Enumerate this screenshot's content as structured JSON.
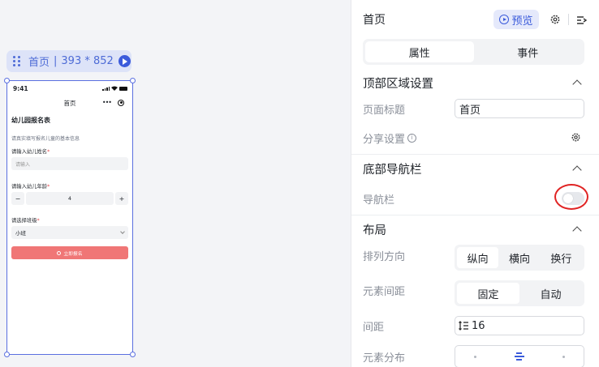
{
  "canvas": {
    "page_chip": {
      "name": "首页",
      "size": "393 * 852"
    },
    "phone": {
      "time": "9:41",
      "nav_title": "首页",
      "nav_dots": "•••",
      "form": {
        "title": "幼儿园报名表",
        "desc": "请真实填写报名儿童的基本信息",
        "name_label": "请输入幼儿姓名",
        "name_placeholder": "请输入",
        "age_label": "请输入幼儿年龄",
        "age_minus": "−",
        "age_value": "4",
        "age_plus": "+",
        "class_label": "请选择班级",
        "class_value": "小班",
        "required_mark": "*",
        "submit_label": "立即报名"
      }
    }
  },
  "panel": {
    "title": "首页",
    "preview_label": "预览",
    "tabs": [
      {
        "label": "属性",
        "active": true
      },
      {
        "label": "事件",
        "active": false
      }
    ],
    "top_section": {
      "title": "顶部区域设置",
      "page_title_label": "页面标题",
      "page_title_value": "首页",
      "share_label": "分享设置"
    },
    "bottom_section": {
      "title": "底部导航栏",
      "navbar_label": "导航栏",
      "navbar_enabled": false
    },
    "layout_section": {
      "title": "布局",
      "direction_label": "排列方向",
      "direction_options": [
        "纵向",
        "横向",
        "换行"
      ],
      "direction_selected": "纵向",
      "spacing_label": "元素间距",
      "spacing_options": [
        "固定",
        "自动"
      ],
      "spacing_selected": "固定",
      "gap_label": "间距",
      "gap_value": "16",
      "distribution_label": "元素分布"
    }
  },
  "colors": {
    "accent": "#3b5bdb",
    "submit": "#f07676",
    "highlight_ring": "#e02424"
  }
}
